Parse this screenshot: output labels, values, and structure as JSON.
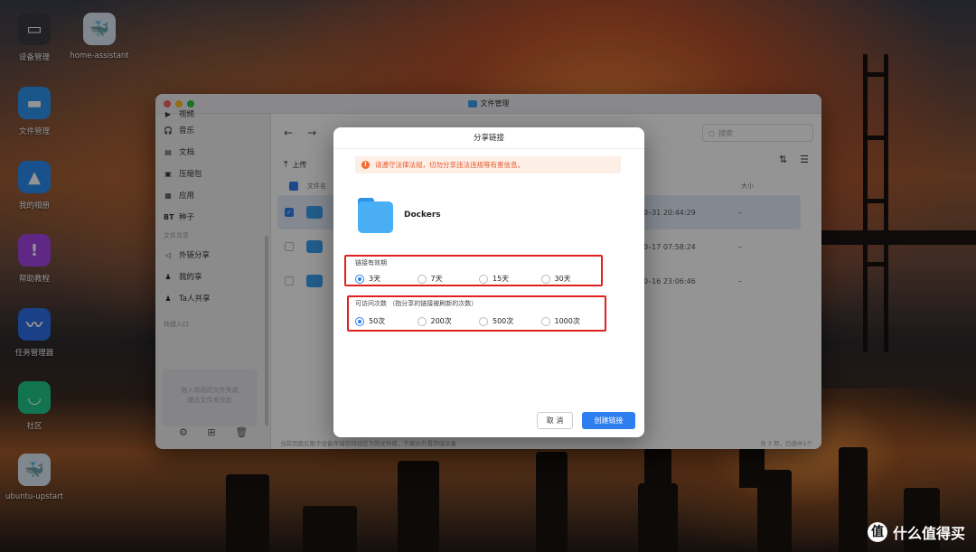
{
  "desktop": {
    "icons": [
      {
        "label": "设备管理",
        "icon": "device-icon",
        "color": "#3b3b3f"
      },
      {
        "label": "home-assistant",
        "icon": "docker-icon",
        "color": "#dfe9f5"
      },
      {
        "label": "文件管理",
        "icon": "folder-icon",
        "color": "#2f95ef"
      },
      {
        "label": "我的相册",
        "icon": "photo-icon",
        "color": "#2a8cf0"
      },
      {
        "label": "帮助教程",
        "icon": "help-icon",
        "color": "#a445e6"
      },
      {
        "label": "任务管理器",
        "icon": "chart-icon",
        "color": "#2e6fe8"
      },
      {
        "label": "社区",
        "icon": "community-icon",
        "color": "#1fc98a"
      },
      {
        "label": "ubuntu-upstart",
        "icon": "docker-icon",
        "color": "#dfe9f5"
      }
    ]
  },
  "window": {
    "title": "文件管理",
    "sidebar": {
      "partial_top": "视频",
      "items": [
        {
          "icon": "🎧",
          "label": "音乐"
        },
        {
          "icon": "▤",
          "label": "文档"
        },
        {
          "icon": "▣",
          "label": "压缩包"
        },
        {
          "icon": "▦",
          "label": "应用"
        },
        {
          "icon": "BT",
          "label": "种子"
        }
      ],
      "share_header": "文件共享",
      "share_items": [
        {
          "icon": "◁",
          "label": "外链分享"
        },
        {
          "icon": "♟",
          "label": "我的享"
        },
        {
          "icon": "♟",
          "label": "Ta人共享"
        }
      ],
      "quick_header": "快捷入口",
      "quick_hint_1": "拖入常用的文件夹或",
      "quick_hint_2": "键击文件夹添加"
    },
    "toolbar": {
      "search_placeholder": "搜索",
      "upload_label": "上传"
    },
    "table": {
      "col_name": "文件名",
      "col_size": "大小",
      "rows": [
        {
          "date": "0–31 20:44:29",
          "size": "–",
          "selected": true
        },
        {
          "date": "0–17 07:58:24",
          "size": "–",
          "selected": false
        },
        {
          "date": "0–16 23:06:46",
          "size": "–",
          "selected": false
        }
      ]
    },
    "status_left": "当前页面仅限于设备存储空间对应下的文件库，不展示外置存储设备",
    "status_right": "共 3 项，已选中1个"
  },
  "dialog": {
    "title": "分享链接",
    "warning": "请遵守法律法规，切勿分享违法违规等有害信息。",
    "folder_name": "Dockers",
    "validity": {
      "label": "链接有效期",
      "options": [
        "3天",
        "7天",
        "15天",
        "30天"
      ],
      "selected": 0
    },
    "visits": {
      "label": "可访问次数 （指分享的链接被刷新的次数）",
      "options": [
        "50次",
        "200次",
        "500次",
        "1000次"
      ],
      "selected": 0
    },
    "cancel_label": "取 消",
    "create_label": "创建链接",
    "highlight_color": "#e0201e",
    "accent_color": "#2f7ef0"
  },
  "watermark": {
    "text": "什么值得买",
    "logo": "值"
  }
}
